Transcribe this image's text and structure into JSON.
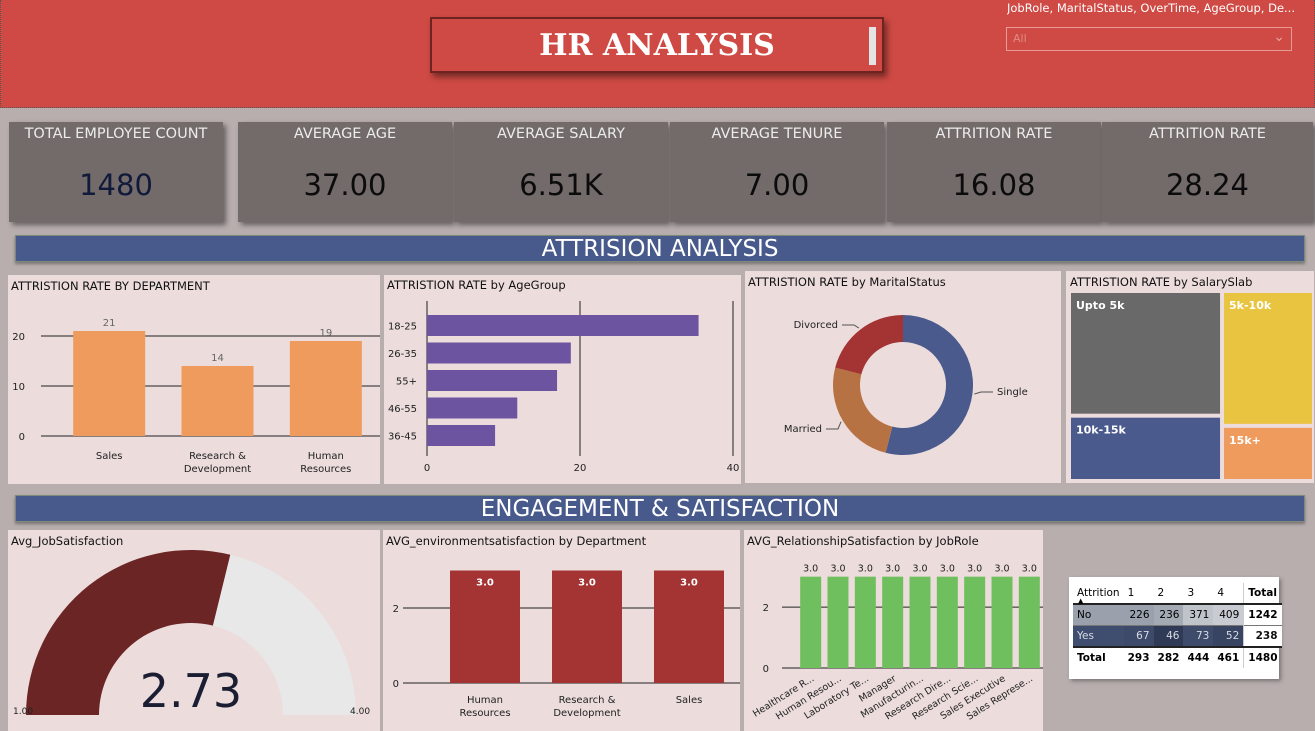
{
  "header": {
    "title": "HR ANALYSIS",
    "slicer_title": "JobRole, MaritalStatus, OverTime, AgeGroup, De...",
    "slicer_value": "All"
  },
  "kpis": [
    {
      "label": "TOTAL EMPLOYEE COUNT",
      "value": "1480"
    },
    {
      "label": "AVERAGE AGE",
      "value": "37.00"
    },
    {
      "label": "AVERAGE SALARY",
      "value": "6.51K"
    },
    {
      "label": "AVERAGE TENURE",
      "value": "7.00"
    },
    {
      "label": "ATTRITION RATE",
      "value": "16.08"
    },
    {
      "label": "ATTRITION RATE",
      "value": "28.24"
    }
  ],
  "sections": {
    "attrition": "ATTRISION ANALYSIS",
    "engagement": "ENGAGEMENT & SATISFACTION"
  },
  "chart_data": [
    {
      "type": "bar",
      "title": "ATTRISTION RATE BY DEPARTMENT",
      "categories": [
        "Sales",
        "Research & Development",
        "Human Resources"
      ],
      "category_lines": [
        [
          "Sales"
        ],
        [
          "Research &",
          "Development"
        ],
        [
          "Human",
          "Resources"
        ]
      ],
      "values": [
        21,
        14,
        19
      ],
      "yticks": [
        0,
        10,
        20
      ],
      "ylim": [
        0,
        25
      ],
      "color": "#ef9b5e"
    },
    {
      "type": "bar",
      "orientation": "horizontal",
      "title": "ATTRISTION RATE by AgeGroup",
      "categories": [
        "18-25",
        "26-35",
        "55+",
        "46-55",
        "36-45"
      ],
      "values": [
        35.5,
        18.8,
        17.0,
        11.8,
        8.9
      ],
      "xticks": [
        0,
        20,
        40
      ],
      "xlim": [
        0,
        40
      ],
      "color": "#6c54a0"
    },
    {
      "type": "pie",
      "title": "ATTRISTION RATE by MaritalStatus",
      "labels": [
        "Single",
        "Married",
        "Divorced"
      ],
      "values": [
        54,
        25,
        21
      ],
      "colors": [
        "#4a5a8d",
        "#b77244",
        "#a43333"
      ]
    },
    {
      "type": "treemap",
      "title": "ATTRISTION RATE by SalarySlab",
      "labels": [
        "Upto 5k",
        "10k-15k",
        "5k-10k",
        "15k+"
      ],
      "values": [
        31,
        16,
        20,
        8
      ],
      "colors": [
        "#696969",
        "#4a5a8d",
        "#e9c441",
        "#ef9b5e"
      ]
    },
    {
      "type": "gauge",
      "title": "Avg_JobSatisfaction",
      "value": "2.73",
      "value_num": 2.73,
      "min": "1.00",
      "max": "4.00",
      "min_num": 1,
      "max_num": 4,
      "fill_color": "#6b2524",
      "track_color": "#e8e8e8"
    },
    {
      "type": "bar",
      "title": "AVG_environmentsatisfaction by Department",
      "categories": [
        "Human Resources",
        "Research & Development",
        "Sales"
      ],
      "category_lines": [
        [
          "Human",
          "Resources"
        ],
        [
          "Research &",
          "Development"
        ],
        [
          "Sales"
        ]
      ],
      "values": [
        3.0,
        3.0,
        3.0
      ],
      "data_labels": [
        "3.0",
        "3.0",
        "3.0"
      ],
      "yticks": [
        0,
        2
      ],
      "ylim": [
        0,
        3.2
      ],
      "color": "#a33433"
    },
    {
      "type": "bar",
      "title": "AVG_RelationshipSatisfaction by JobRole",
      "categories": [
        "Healthcare R...",
        "Human Resou...",
        "Laboratory Te...",
        "Manager",
        "Manufacturin...",
        "Research Dire...",
        "Research Scie...",
        "Sales Executive",
        "Sales Represe..."
      ],
      "values": [
        3.0,
        3.0,
        3.0,
        3.0,
        3.0,
        3.0,
        3.0,
        3.0,
        3.0
      ],
      "data_labels": [
        "3.0",
        "3.0",
        "3.0",
        "3.0",
        "3.0",
        "3.0",
        "3.0",
        "3.0",
        "3.0"
      ],
      "yticks": [
        0,
        2
      ],
      "ylim": [
        0,
        3.35
      ],
      "color": "#6fbf5e"
    },
    {
      "type": "table",
      "columns": [
        "Attrition",
        "1",
        "2",
        "3",
        "4",
        "Total"
      ],
      "rows": [
        [
          "No",
          "226",
          "236",
          "371",
          "409",
          "1242"
        ],
        [
          "Yes",
          "67",
          "46",
          "73",
          "52",
          "238"
        ],
        [
          "Total",
          "293",
          "282",
          "444",
          "461",
          "1480"
        ]
      ]
    }
  ]
}
